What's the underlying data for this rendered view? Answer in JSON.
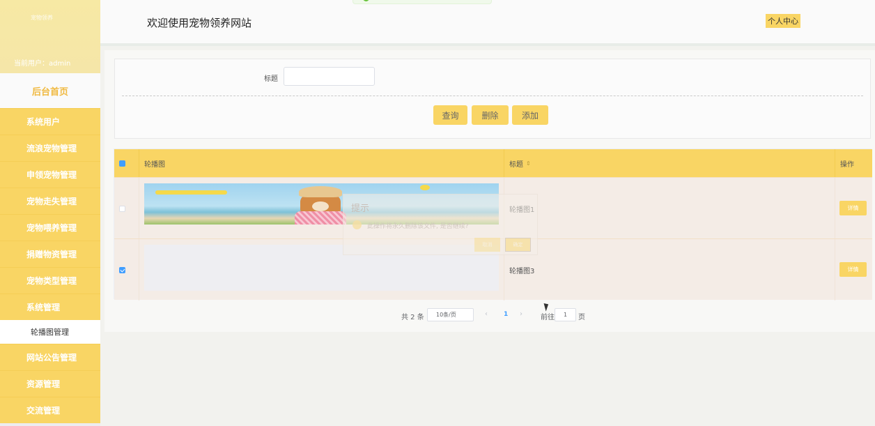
{
  "sidebar": {
    "logo_text": "宠物领养",
    "current_user_label": "当前用户：",
    "current_user": "admin",
    "home": "后台首页",
    "items": [
      {
        "label": "系统用户"
      },
      {
        "label": "流浪宠物管理"
      },
      {
        "label": "申领宠物管理"
      },
      {
        "label": "宠物走失管理"
      },
      {
        "label": "宠物喂养管理"
      },
      {
        "label": "捐赠物资管理"
      },
      {
        "label": "宠物类型管理"
      },
      {
        "label": "系统管理"
      }
    ],
    "sub_item": "轮播图管理",
    "items_after": [
      {
        "label": "网站公告管理"
      },
      {
        "label": "资源管理"
      },
      {
        "label": "交流管理"
      }
    ]
  },
  "header": {
    "title": "欢迎使用宠物领养网站",
    "personal_center": "个人中心"
  },
  "search": {
    "label": "标题",
    "value": "",
    "buttons": {
      "query": "查询",
      "delete": "删除",
      "add": "添加"
    }
  },
  "table": {
    "columns": [
      "轮播图",
      "标题",
      "操作"
    ],
    "sort_icon": "sort-icon",
    "rows": [
      {
        "title": "轮播图1",
        "checked": false,
        "action": "详情"
      },
      {
        "title": "轮播图3",
        "checked": true,
        "action": "详情"
      }
    ]
  },
  "pagination": {
    "total": "共 2 条",
    "page_size": "10条/页",
    "prev": "‹",
    "current": "1",
    "next": "›",
    "goto": "前往",
    "jump_value": "1",
    "page_suffix": "页"
  },
  "dialog": {
    "title": "提示",
    "message": "此操作将永久删除该文件, 是否继续?",
    "cancel": "取消",
    "confirm": "确定"
  },
  "colors": {
    "accent": "#f9d564",
    "primary": "#409eff"
  }
}
